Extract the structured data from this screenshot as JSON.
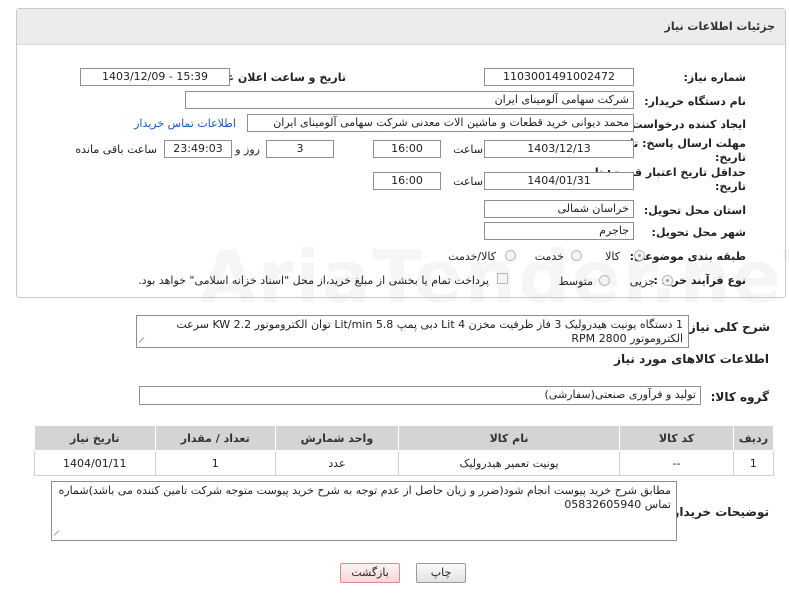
{
  "header": {
    "title": "جزئیات اطلاعات نیاز"
  },
  "fields": {
    "need_number_label": "شماره نیاز:",
    "need_number": "1103001491002472",
    "announce_label": "تاریخ و ساعت اعلان عمومی:",
    "announce_value": "1403/12/09 - 15:39",
    "buyer_org_label": "نام دستگاه خریدار:",
    "buyer_org": "شرکت سهامی آلومینای ایران",
    "requester_label": "ایجاد کننده درخواست:",
    "requester": "محمد دیوانی خرید قطعات و ماشین الات معدنی شرکت سهامی آلومینای ایران",
    "contact_link": "اطلاعات تماس خریدار",
    "deadline_label_1": "مهلت ارسال پاسخ: تا",
    "deadline_label_2": "تاریخ:",
    "deadline_date": "1403/12/13",
    "time_word": "ساعت",
    "deadline_time": "16:00",
    "days_value": "3",
    "day_and_word": "روز و",
    "remaining_time": "23:49:03",
    "remaining_suffix": "ساعت باقی مانده",
    "validity_label_1": "حداقل تاریخ اعتبار قیمت: تا",
    "validity_label_2": "تاریخ:",
    "validity_date": "1404/01/31",
    "validity_time": "16:00",
    "province_label": "استان محل تحویل:",
    "province": "خراسان شمالی",
    "city_label": "شهر محل تحویل:",
    "city": "جاجرم",
    "category_label": "طبقه بندی موضوعی:",
    "category_options": [
      "کالا",
      "خدمت",
      "کالا/خدمت"
    ],
    "process_label": "نوع فرآیند خرید :",
    "process_options": [
      "جزیی",
      "متوسط"
    ],
    "process_note": "پرداخت تمام یا بخشی از مبلغ خرید،از محل \"اسناد خزانه اسلامی\" خواهد بود."
  },
  "description": {
    "label": "شرح کلی نیاز:",
    "text": "1 دستگاه یونیت هیدرولیک 3 فاز ظرفیت مخزن 4 Lit دبی پمپ 5.8 Lit/min توان الکتروموتور 2.2 KW سرعت الکتروموتور 2800 RPM"
  },
  "goods": {
    "section_title": "اطلاعات کالاهای مورد نیاز",
    "group_label": "گروه کالا:",
    "group_value": "تولید و فرآوری صنعتی(سفارشی)",
    "columns": [
      "ردیف",
      "کد کالا",
      "نام کالا",
      "واحد شمارش",
      "تعداد / مقدار",
      "تاریخ نیاز"
    ],
    "rows": [
      [
        "1",
        "--",
        "یونیت تعمیر هیدرولیک",
        "عدد",
        "1",
        "1404/01/11"
      ]
    ]
  },
  "buyer_notes": {
    "label": "توضیحات خریدار:",
    "text": "مطابق شرح خرید پیوست انجام شود(ضرر و زیان حاصل از عدم توجه به شرح خرید پیوست متوجه شرکت تامین کننده می باشد)شماره تماس 05832605940"
  },
  "buttons": {
    "print": "چاپ",
    "back": "بازگشت"
  },
  "watermark": "AriaTender.neT"
}
